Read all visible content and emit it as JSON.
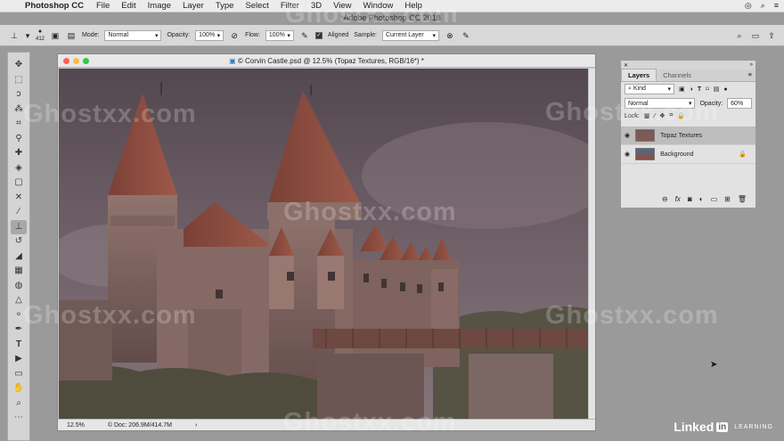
{
  "menubar": {
    "app": "Photoshop CC",
    "items": [
      "File",
      "Edit",
      "Image",
      "Layer",
      "Type",
      "Select",
      "Filter",
      "3D",
      "View",
      "Window",
      "Help"
    ],
    "center_title": "Adobe Photoshop CC 2018"
  },
  "options": {
    "brush_size": "412",
    "mode_label": "Mode:",
    "mode_value": "Normal",
    "opacity_label": "Opacity:",
    "opacity_value": "100%",
    "flow_label": "Flow:",
    "flow_value": "100%",
    "aligned_label": "Aligned",
    "sample_label": "Sample:",
    "sample_value": "Current Layer"
  },
  "document": {
    "title": "© Corvin Castle.psd @ 12.5% (Topaz Textures, RGB/16*) *",
    "zoom": "12.5%",
    "doc_info": "Doc: 206.9M/414.7M"
  },
  "layers_panel": {
    "tabs": [
      "Layers",
      "Channels"
    ],
    "filter_kind": "Kind",
    "blend_mode": "Normal",
    "opacity_label": "Opacity:",
    "opacity_value": "60%",
    "lock_label": "Lock:",
    "layers": [
      {
        "name": "Topaz Textures",
        "selected": true
      },
      {
        "name": "Background",
        "selected": false
      }
    ]
  },
  "watermark_text": "Ghostxx.com",
  "brand": {
    "name": "Linked",
    "in": "in",
    "suffix": "LEARNING"
  },
  "colors": {
    "accent_brick": "#8a4a3a",
    "sky": "#5e5560",
    "panel_bg": "#e2e2e2"
  }
}
